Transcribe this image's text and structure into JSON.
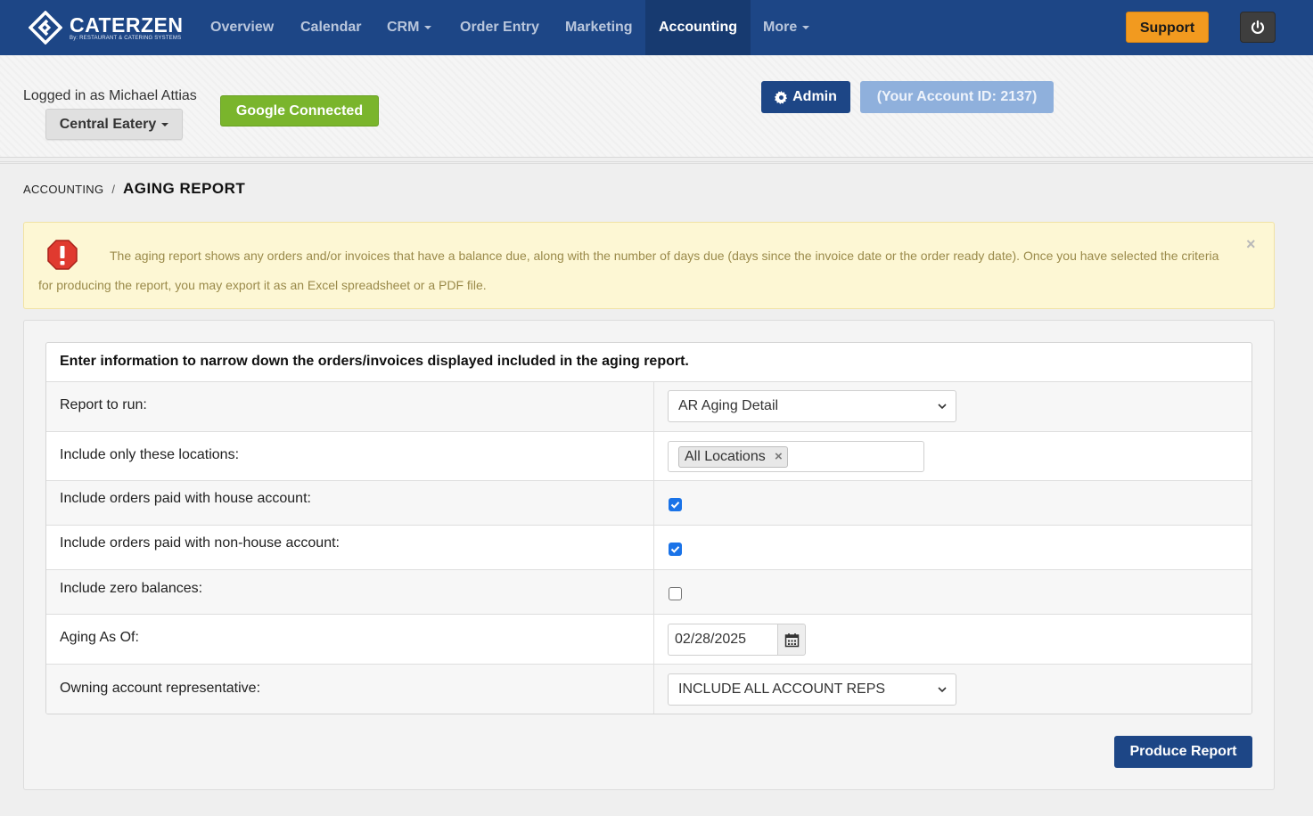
{
  "brand": {
    "name": "CATERZEN",
    "tagline": "By: RESTAURANT & CATERING SYSTEMS",
    "color": "#1d4686"
  },
  "nav": {
    "items": [
      {
        "label": "Overview"
      },
      {
        "label": "Calendar"
      },
      {
        "label": "CRM"
      },
      {
        "label": "Order Entry"
      },
      {
        "label": "Marketing"
      },
      {
        "label": "Accounting"
      },
      {
        "label": "More"
      }
    ],
    "support_label": "Support",
    "power_icon": "power-icon",
    "support_color": "#f29a1f"
  },
  "subheader": {
    "logged_in": "Logged in as Michael Attias",
    "location": "Central Eatery",
    "google": "Google Connected",
    "admin": "Admin",
    "account": "(Your Account ID: 2137)",
    "google_color": "#7ab52c"
  },
  "breadcrumb": {
    "parent": "ACCOUNTING",
    "separator": "/",
    "current": "AGING REPORT"
  },
  "alert": {
    "icon": "exclamation-icon",
    "text": "The aging report shows any orders and/or invoices that have a balance due, along with the number of days due (days since the invoice date or the order ready date). Once you have selected the criteria for producing the report, you may export it as an Excel spreadsheet or a PDF file.",
    "close": "×"
  },
  "form": {
    "heading": "Enter information to narrow down the orders/invoices displayed included in the aging report.",
    "report_label": "Report to run:",
    "report_value": "AR Aging Detail",
    "locations_label": "Include only these locations:",
    "locations_tag": "All Locations",
    "tag_remove": "×",
    "house_label": "Include orders paid with house account:",
    "house_checked": true,
    "nonhouse_label": "Include orders paid with non-house account:",
    "nonhouse_checked": true,
    "zero_label": "Include zero balances:",
    "zero_checked": false,
    "aging_label": "Aging As Of:",
    "aging_value": "02/28/2025",
    "rep_label": "Owning account representative:",
    "rep_value": "INCLUDE ALL ACCOUNT REPS",
    "submit": "Produce Report"
  }
}
